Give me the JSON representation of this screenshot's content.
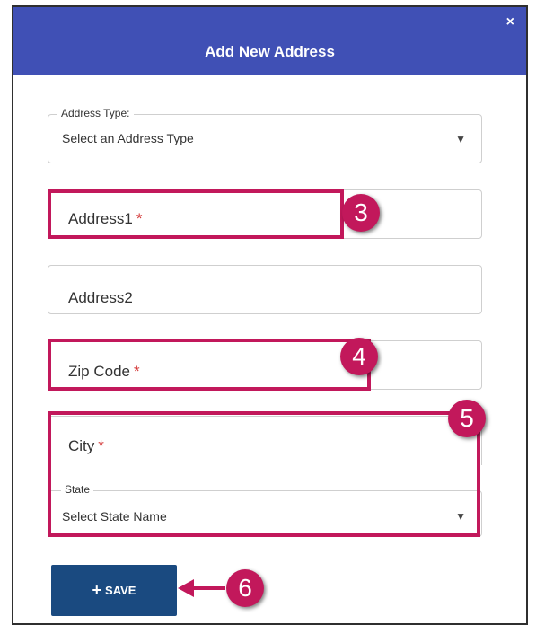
{
  "dialog": {
    "title": "Add New Address",
    "close_label": "×"
  },
  "address_type": {
    "legend": "Address Type:",
    "value": "Select an Address Type",
    "caret": "▼"
  },
  "address1": {
    "label": "Address1",
    "required_mark": "*"
  },
  "address2": {
    "label": "Address2"
  },
  "zip": {
    "label": "Zip Code",
    "required_mark": "*"
  },
  "city": {
    "label": "City",
    "required_mark": "*"
  },
  "state": {
    "legend": "State",
    "value": "Select State Name",
    "caret": "▼"
  },
  "save_button": {
    "icon": "+",
    "label": "SAVE"
  },
  "callouts": [
    "3",
    "4",
    "5",
    "6"
  ],
  "colors": {
    "header": "#4050b5",
    "highlight": "#c2185b",
    "save": "#1a4a80",
    "required": "#d33333"
  }
}
